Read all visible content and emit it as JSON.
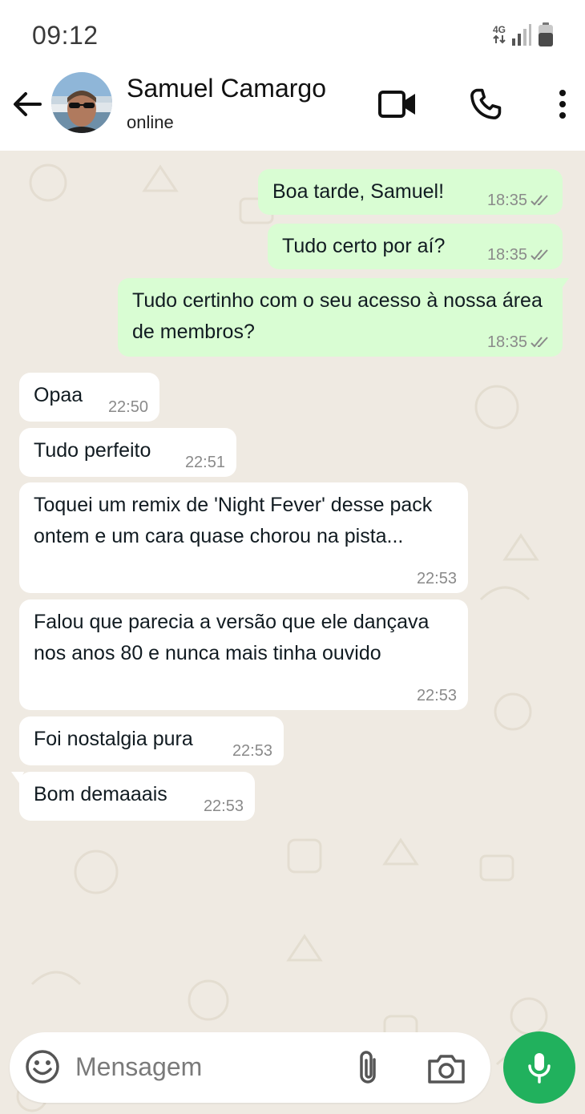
{
  "statusbar": {
    "time": "09:12",
    "network": "4G"
  },
  "contact": {
    "name": "Samuel Camargo",
    "status": "online"
  },
  "input": {
    "placeholder": "Mensagem"
  },
  "messages": [
    {
      "dir": "out",
      "text": "Boa tarde, Samuel!",
      "time": "18:35",
      "read": true
    },
    {
      "dir": "out",
      "text": "Tudo certo por aí?",
      "time": "18:35",
      "read": true
    },
    {
      "dir": "out",
      "text": "Tudo certinho com o seu acesso à nossa área de membros?",
      "time": "18:35",
      "read": true
    },
    {
      "dir": "in",
      "text": "Opaa",
      "time": "22:50"
    },
    {
      "dir": "in",
      "text": "Tudo perfeito",
      "time": "22:51"
    },
    {
      "dir": "in",
      "text": "Toquei um remix de 'Night Fever' desse pack ontem e um cara quase chorou na pista...",
      "time": "22:53"
    },
    {
      "dir": "in",
      "text": "Falou que parecia a versão que ele dançava nos anos 80 e nunca mais tinha ouvido",
      "time": "22:53"
    },
    {
      "dir": "in",
      "text": "Foi nostalgia pura",
      "time": "22:53"
    },
    {
      "dir": "in",
      "text": "Bom demaaais",
      "time": "22:53"
    }
  ],
  "colors": {
    "outgoing_bubble": "#d9fdd3",
    "incoming_bubble": "#ffffff",
    "chat_background": "#efeae2",
    "accent": "#21b15d"
  }
}
